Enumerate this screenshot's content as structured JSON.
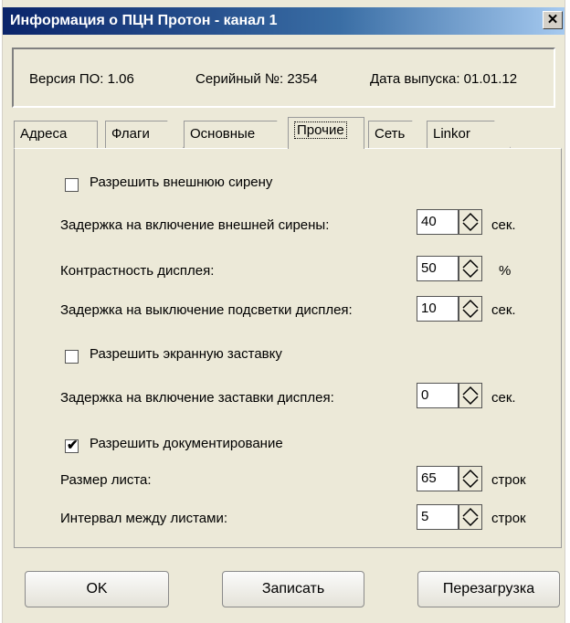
{
  "window": {
    "title": "Информация о ПЦН Протон - канал 1",
    "close_glyph": "✕"
  },
  "info": {
    "version": "Версия ПО: 1.06",
    "serial": "Серийный №: 2354",
    "release": "Дата выпуска: 01.01.12"
  },
  "tabs": [
    "Адреса",
    "Флаги",
    "Основные",
    "Прочие",
    "Сеть",
    "Linkor"
  ],
  "active_tab": "Прочие",
  "settings": {
    "ext_siren_enable": {
      "label": "Разрешить внешнюю сирену",
      "checked": false
    },
    "ext_siren_delay": {
      "label": "Задержка на включение внешней сирены:",
      "value": "40",
      "unit": "сек."
    },
    "contrast": {
      "label": "Контрастность дисплея:",
      "value": "50",
      "unit": "%"
    },
    "backlight_delay": {
      "label": "Задержка на выключение подсветки дисплея:",
      "value": "10",
      "unit": "сек."
    },
    "screensaver_enable": {
      "label": "Разрешить экранную заставку",
      "checked": false
    },
    "screensaver_delay": {
      "label": "Задержка на включение заставки дисплея:",
      "value": "0",
      "unit": "сек."
    },
    "documenting_enable": {
      "label": "Разрешить документирование",
      "checked": true,
      "check_glyph": "✔"
    },
    "sheet_size": {
      "label": "Размер листа:",
      "value": "65",
      "unit": "строк"
    },
    "sheet_interval": {
      "label": "Интервал между листами:",
      "value": "5",
      "unit": "строк"
    }
  },
  "buttons": {
    "ok": "OK",
    "write": "Записать",
    "reboot": "Перезагрузка"
  }
}
